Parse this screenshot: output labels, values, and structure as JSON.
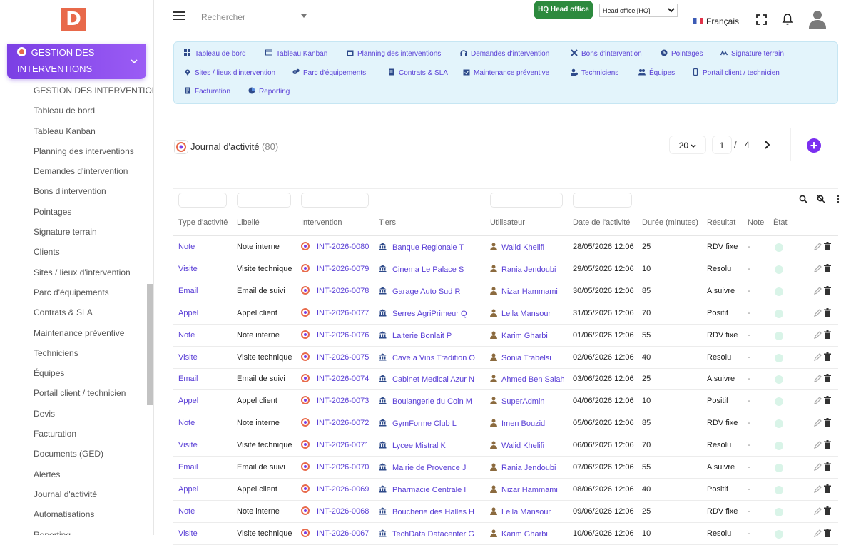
{
  "app": {
    "logo_letter": "D"
  },
  "topbar": {
    "search_placeholder": "Rechercher",
    "hq_badge": "HQ Head office",
    "hq_select": "Head office [HQ]",
    "language": "Français"
  },
  "sidebar": {
    "section_title": "GESTION DES INTERVENTIONS",
    "items": [
      "GESTION DES INTERVENTIONS",
      "Tableau de bord",
      "Tableau Kanban",
      "Planning des interventions",
      "Demandes d'intervention",
      "Bons d'intervention",
      "Pointages",
      "Signature terrain",
      "Clients",
      "Sites / lieux d'intervention",
      "Parc d'équipements",
      "Contrats & SLA",
      "Maintenance préventive",
      "Techniciens",
      "Équipes",
      "Portail client / technicien",
      "Devis",
      "Facturation",
      "Documents (GED)",
      "Alertes",
      "Journal d'activité",
      "Automatisations",
      "Reporting"
    ]
  },
  "nav": {
    "links": [
      {
        "label": "Tableau de bord",
        "icon": "grid-icon"
      },
      {
        "label": "Tableau Kanban",
        "icon": "kanban-icon"
      },
      {
        "label": "Planning des interventions",
        "icon": "calendar-icon"
      },
      {
        "label": "Demandes d'intervention",
        "icon": "headset-icon"
      },
      {
        "label": "Bons d'intervention",
        "icon": "tools-icon"
      },
      {
        "label": "Pointages",
        "icon": "clock-icon"
      },
      {
        "label": "Signature terrain",
        "icon": "signature-icon"
      },
      {
        "label": "Sites / lieux d'intervention",
        "icon": "map-pin-icon"
      },
      {
        "label": "Parc d'équipements",
        "icon": "gears-icon"
      },
      {
        "label": "Contrats & SLA",
        "icon": "contract-icon"
      },
      {
        "label": "Maintenance préventive",
        "icon": "calendar-check-icon"
      },
      {
        "label": "Techniciens",
        "icon": "user-gear-icon"
      },
      {
        "label": "Équipes",
        "icon": "users-icon"
      },
      {
        "label": "Portail client / technicien",
        "icon": "mobile-icon"
      },
      {
        "label": "Facturation",
        "icon": "invoice-icon"
      },
      {
        "label": "Reporting",
        "icon": "chart-pie-icon"
      }
    ]
  },
  "journal": {
    "title": "Journal d'activité",
    "count": "(80)",
    "page_size": "20",
    "page": "1",
    "page_sep": "/",
    "total_pages": "4"
  },
  "table": {
    "headers": [
      "Type d'activité",
      "Libellé",
      "Intervention",
      "Tiers",
      "Utilisateur",
      "Date de l'activité",
      "Durée (minutes)",
      "Résultat",
      "Note",
      "État"
    ],
    "rows": [
      [
        "Note",
        "Note interne",
        "INT-2026-0080",
        "Banque Regionale T",
        "Walid Khelifi",
        "28/05/2026 12:06",
        "25",
        "RDV fixe",
        "-"
      ],
      [
        "Visite",
        "Visite technique",
        "INT-2026-0079",
        "Cinema Le Palace S",
        "Rania Jendoubi",
        "29/05/2026 12:06",
        "10",
        "Resolu",
        "-"
      ],
      [
        "Email",
        "Email de suivi",
        "INT-2026-0078",
        "Garage Auto Sud R",
        "Nizar Hammami",
        "30/05/2026 12:06",
        "85",
        "A suivre",
        "-"
      ],
      [
        "Appel",
        "Appel client",
        "INT-2026-0077",
        "Serres AgriPrimeur Q",
        "Leila Mansour",
        "31/05/2026 12:06",
        "70",
        "Positif",
        "-"
      ],
      [
        "Note",
        "Note interne",
        "INT-2026-0076",
        "Laiterie Bonlait P",
        "Karim Gharbi",
        "01/06/2026 12:06",
        "55",
        "RDV fixe",
        "-"
      ],
      [
        "Visite",
        "Visite technique",
        "INT-2026-0075",
        "Cave a Vins Tradition O",
        "Sonia Trabelsi",
        "02/06/2026 12:06",
        "40",
        "Resolu",
        "-"
      ],
      [
        "Email",
        "Email de suivi",
        "INT-2026-0074",
        "Cabinet Medical Azur N",
        "Ahmed Ben Salah",
        "03/06/2026 12:06",
        "25",
        "A suivre",
        "-"
      ],
      [
        "Appel",
        "Appel client",
        "INT-2026-0073",
        "Boulangerie du Coin M",
        "SuperAdmin",
        "04/06/2026 12:06",
        "10",
        "Positif",
        "-"
      ],
      [
        "Note",
        "Note interne",
        "INT-2026-0072",
        "GymForme Club L",
        "Imen Bouzid",
        "05/06/2026 12:06",
        "85",
        "RDV fixe",
        "-"
      ],
      [
        "Visite",
        "Visite technique",
        "INT-2026-0071",
        "Lycee Mistral K",
        "Walid Khelifi",
        "06/06/2026 12:06",
        "70",
        "Resolu",
        "-"
      ],
      [
        "Email",
        "Email de suivi",
        "INT-2026-0070",
        "Mairie de Provence J",
        "Rania Jendoubi",
        "07/06/2026 12:06",
        "55",
        "A suivre",
        "-"
      ],
      [
        "Appel",
        "Appel client",
        "INT-2026-0069",
        "Pharmacie Centrale I",
        "Nizar Hammami",
        "08/06/2026 12:06",
        "40",
        "Positif",
        "-"
      ],
      [
        "Note",
        "Note interne",
        "INT-2026-0068",
        "Boucherie des Halles H",
        "Leila Mansour",
        "09/06/2026 12:06",
        "25",
        "RDV fixe",
        "-"
      ],
      [
        "Visite",
        "Visite technique",
        "INT-2026-0067",
        "TechData Datacenter G",
        "Karim Gharbi",
        "10/06/2026 12:06",
        "10",
        "Resolu",
        "-"
      ]
    ]
  },
  "colors": {
    "accent": "#7b3fe4",
    "link": "#5a3fd6",
    "hq_green": "#2d8a3e",
    "logo": "#e8694a"
  }
}
